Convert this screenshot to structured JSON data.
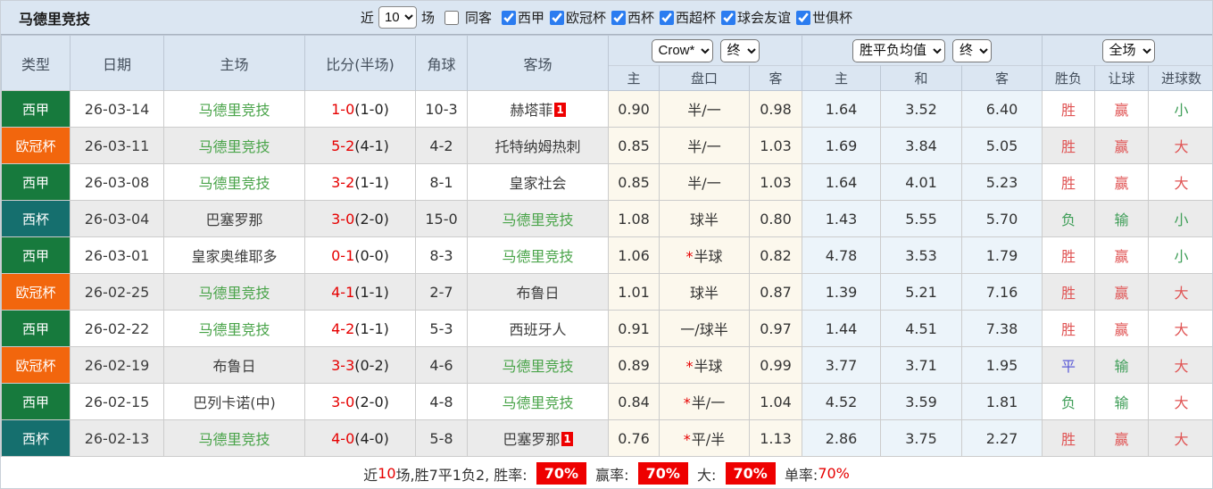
{
  "title": "马德里竞技",
  "colors": {
    "score_red": "#e60000",
    "self_green": "#4aa44a",
    "win_red": "#e05454",
    "lose_green": "#3f9e58",
    "draw_blue": "#5b5bd6",
    "badge_red": "#ee0000"
  },
  "filter_bar": {
    "recent_label": "近",
    "recent_value": "10",
    "games_label": "场",
    "same_venue": {
      "label": "同客",
      "checked": false
    },
    "leagues": [
      {
        "label": "西甲",
        "checked": true
      },
      {
        "label": "欧冠杯",
        "checked": true
      },
      {
        "label": "西杯",
        "checked": true
      },
      {
        "label": "西超杯",
        "checked": true
      },
      {
        "label": "球会友谊",
        "checked": true
      },
      {
        "label": "世俱杯",
        "checked": true
      }
    ]
  },
  "table": {
    "columns": {
      "type": "类型",
      "date": "日期",
      "home": "主场",
      "score": "比分(半场)",
      "corner": "角球",
      "away": "客场",
      "bookmaker_select": "Crow*",
      "bookmaker_time_select": "终",
      "odds_select": "胜平负均值",
      "odds_time_select": "终",
      "scope_select": "全场",
      "sub": [
        "主",
        "盘口",
        "客",
        "主",
        "和",
        "客",
        "胜负",
        "让球",
        "进球数"
      ]
    },
    "rows": [
      {
        "type": {
          "text": "西甲",
          "bg": "#177a3d"
        },
        "date": "26-03-14",
        "home": {
          "name": "马德里竞技",
          "self": true,
          "card": ""
        },
        "score": {
          "full": "1-0",
          "half": "(1-0)"
        },
        "corner": "10-3",
        "away": {
          "name": "赫塔菲",
          "self": false,
          "card": "1"
        },
        "crow_home": "0.90",
        "handicap": {
          "star": false,
          "text": "半/一"
        },
        "crow_away": "0.98",
        "avg_home": "1.64",
        "avg_draw": "3.52",
        "avg_away": "6.40",
        "res_wdl": {
          "text": "胜",
          "cls": "red"
        },
        "res_handicap": {
          "text": "赢",
          "cls": "red"
        },
        "res_goals": {
          "text": "小",
          "cls": "green"
        }
      },
      {
        "type": {
          "text": "欧冠杯",
          "bg": "#f2660d"
        },
        "date": "26-03-11",
        "home": {
          "name": "马德里竞技",
          "self": true,
          "card": ""
        },
        "score": {
          "full": "5-2",
          "half": "(4-1)"
        },
        "corner": "4-2",
        "away": {
          "name": "托特纳姆热刺",
          "self": false,
          "card": ""
        },
        "crow_home": "0.85",
        "handicap": {
          "star": false,
          "text": "半/一"
        },
        "crow_away": "1.03",
        "avg_home": "1.69",
        "avg_draw": "3.84",
        "avg_away": "5.05",
        "res_wdl": {
          "text": "胜",
          "cls": "red"
        },
        "res_handicap": {
          "text": "赢",
          "cls": "red"
        },
        "res_goals": {
          "text": "大",
          "cls": "red"
        }
      },
      {
        "type": {
          "text": "西甲",
          "bg": "#177a3d"
        },
        "date": "26-03-08",
        "home": {
          "name": "马德里竞技",
          "self": true,
          "card": ""
        },
        "score": {
          "full": "3-2",
          "half": "(1-1)"
        },
        "corner": "8-1",
        "away": {
          "name": "皇家社会",
          "self": false,
          "card": ""
        },
        "crow_home": "0.85",
        "handicap": {
          "star": false,
          "text": "半/一"
        },
        "crow_away": "1.03",
        "avg_home": "1.64",
        "avg_draw": "4.01",
        "avg_away": "5.23",
        "res_wdl": {
          "text": "胜",
          "cls": "red"
        },
        "res_handicap": {
          "text": "赢",
          "cls": "red"
        },
        "res_goals": {
          "text": "大",
          "cls": "red"
        }
      },
      {
        "type": {
          "text": "西杯",
          "bg": "#156f6e"
        },
        "date": "26-03-04",
        "home": {
          "name": "巴塞罗那",
          "self": false,
          "card": ""
        },
        "score": {
          "full": "3-0",
          "half": "(2-0)"
        },
        "corner": "15-0",
        "away": {
          "name": "马德里竞技",
          "self": true,
          "card": ""
        },
        "crow_home": "1.08",
        "handicap": {
          "star": false,
          "text": "球半"
        },
        "crow_away": "0.80",
        "avg_home": "1.43",
        "avg_draw": "5.55",
        "avg_away": "5.70",
        "res_wdl": {
          "text": "负",
          "cls": "green"
        },
        "res_handicap": {
          "text": "输",
          "cls": "green"
        },
        "res_goals": {
          "text": "小",
          "cls": "green"
        }
      },
      {
        "type": {
          "text": "西甲",
          "bg": "#177a3d"
        },
        "date": "26-03-01",
        "home": {
          "name": "皇家奥维耶多",
          "self": false,
          "card": ""
        },
        "score": {
          "full": "0-1",
          "half": "(0-0)"
        },
        "corner": "8-3",
        "away": {
          "name": "马德里竞技",
          "self": true,
          "card": ""
        },
        "crow_home": "1.06",
        "handicap": {
          "star": true,
          "text": "半球"
        },
        "crow_away": "0.82",
        "avg_home": "4.78",
        "avg_draw": "3.53",
        "avg_away": "1.79",
        "res_wdl": {
          "text": "胜",
          "cls": "red"
        },
        "res_handicap": {
          "text": "赢",
          "cls": "red"
        },
        "res_goals": {
          "text": "小",
          "cls": "green"
        }
      },
      {
        "type": {
          "text": "欧冠杯",
          "bg": "#f2660d"
        },
        "date": "26-02-25",
        "home": {
          "name": "马德里竞技",
          "self": true,
          "card": ""
        },
        "score": {
          "full": "4-1",
          "half": "(1-1)"
        },
        "corner": "2-7",
        "away": {
          "name": "布鲁日",
          "self": false,
          "card": ""
        },
        "crow_home": "1.01",
        "handicap": {
          "star": false,
          "text": "球半"
        },
        "crow_away": "0.87",
        "avg_home": "1.39",
        "avg_draw": "5.21",
        "avg_away": "7.16",
        "res_wdl": {
          "text": "胜",
          "cls": "red"
        },
        "res_handicap": {
          "text": "赢",
          "cls": "red"
        },
        "res_goals": {
          "text": "大",
          "cls": "red"
        }
      },
      {
        "type": {
          "text": "西甲",
          "bg": "#177a3d"
        },
        "date": "26-02-22",
        "home": {
          "name": "马德里竞技",
          "self": true,
          "card": ""
        },
        "score": {
          "full": "4-2",
          "half": "(1-1)"
        },
        "corner": "5-3",
        "away": {
          "name": "西班牙人",
          "self": false,
          "card": ""
        },
        "crow_home": "0.91",
        "handicap": {
          "star": false,
          "text": "一/球半"
        },
        "crow_away": "0.97",
        "avg_home": "1.44",
        "avg_draw": "4.51",
        "avg_away": "7.38",
        "res_wdl": {
          "text": "胜",
          "cls": "red"
        },
        "res_handicap": {
          "text": "赢",
          "cls": "red"
        },
        "res_goals": {
          "text": "大",
          "cls": "red"
        }
      },
      {
        "type": {
          "text": "欧冠杯",
          "bg": "#f2660d"
        },
        "date": "26-02-19",
        "home": {
          "name": "布鲁日",
          "self": false,
          "card": ""
        },
        "score": {
          "full": "3-3",
          "half": "(0-2)"
        },
        "corner": "4-6",
        "away": {
          "name": "马德里竞技",
          "self": true,
          "card": ""
        },
        "crow_home": "0.89",
        "handicap": {
          "star": true,
          "text": "半球"
        },
        "crow_away": "0.99",
        "avg_home": "3.77",
        "avg_draw": "3.71",
        "avg_away": "1.95",
        "res_wdl": {
          "text": "平",
          "cls": "blue"
        },
        "res_handicap": {
          "text": "输",
          "cls": "green"
        },
        "res_goals": {
          "text": "大",
          "cls": "red"
        }
      },
      {
        "type": {
          "text": "西甲",
          "bg": "#177a3d"
        },
        "date": "26-02-15",
        "home": {
          "name": "巴列卡诺(中)",
          "self": false,
          "card": ""
        },
        "score": {
          "full": "3-0",
          "half": "(2-0)"
        },
        "corner": "4-8",
        "away": {
          "name": "马德里竞技",
          "self": true,
          "card": ""
        },
        "crow_home": "0.84",
        "handicap": {
          "star": true,
          "text": "半/一"
        },
        "crow_away": "1.04",
        "avg_home": "4.52",
        "avg_draw": "3.59",
        "avg_away": "1.81",
        "res_wdl": {
          "text": "负",
          "cls": "green"
        },
        "res_handicap": {
          "text": "输",
          "cls": "green"
        },
        "res_goals": {
          "text": "大",
          "cls": "red"
        }
      },
      {
        "type": {
          "text": "西杯",
          "bg": "#156f6e"
        },
        "date": "26-02-13",
        "home": {
          "name": "马德里竞技",
          "self": true,
          "card": ""
        },
        "score": {
          "full": "4-0",
          "half": "(4-0)"
        },
        "corner": "5-8",
        "away": {
          "name": "巴塞罗那",
          "self": false,
          "card": "1"
        },
        "crow_home": "0.76",
        "handicap": {
          "star": true,
          "text": "平/半"
        },
        "crow_away": "1.13",
        "avg_home": "2.86",
        "avg_draw": "3.75",
        "avg_away": "2.27",
        "res_wdl": {
          "text": "胜",
          "cls": "red"
        },
        "res_handicap": {
          "text": "赢",
          "cls": "red"
        },
        "res_goals": {
          "text": "大",
          "cls": "red"
        }
      }
    ]
  },
  "footer": {
    "segments": [
      {
        "text": "近",
        "style": "plain"
      },
      {
        "text": "10",
        "style": "red"
      },
      {
        "text": "场,胜7平1负2, 胜率: ",
        "style": "plain"
      },
      {
        "text": "70%",
        "style": "badge"
      },
      {
        "text": " 赢率: ",
        "style": "plain"
      },
      {
        "text": "70%",
        "style": "badge"
      },
      {
        "text": " 大: ",
        "style": "plain"
      },
      {
        "text": "70%",
        "style": "badge"
      },
      {
        "text": " 单率:",
        "style": "plain"
      },
      {
        "text": "70%",
        "style": "red"
      }
    ]
  }
}
